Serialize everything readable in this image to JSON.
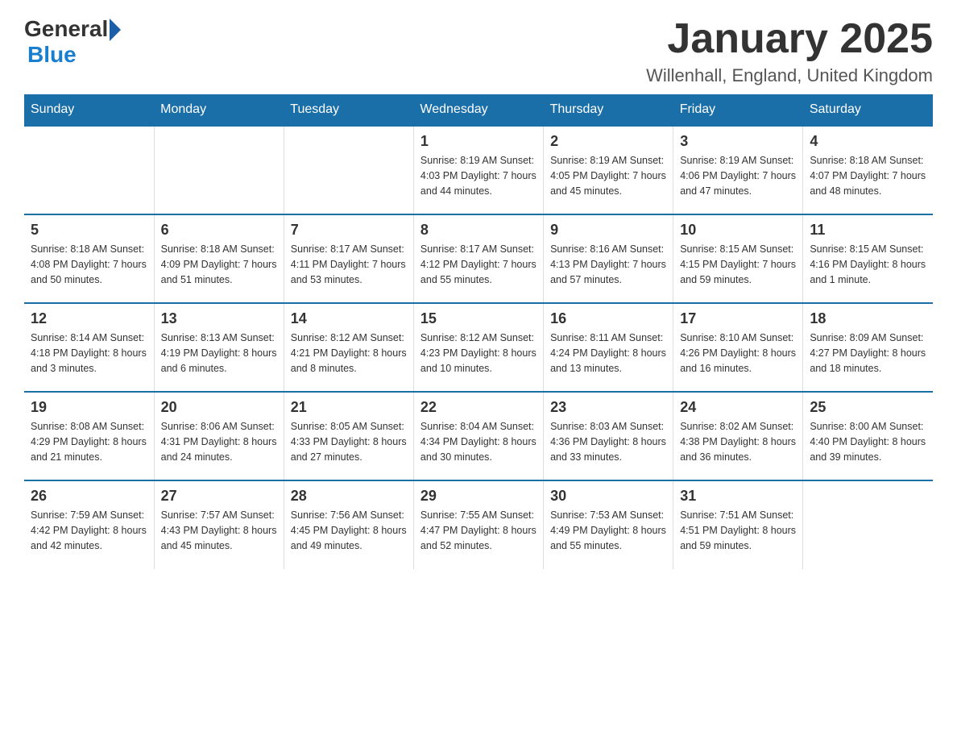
{
  "logo": {
    "text_general": "General",
    "text_blue": "Blue"
  },
  "title": "January 2025",
  "location": "Willenhall, England, United Kingdom",
  "headers": [
    "Sunday",
    "Monday",
    "Tuesday",
    "Wednesday",
    "Thursday",
    "Friday",
    "Saturday"
  ],
  "weeks": [
    [
      {
        "day": "",
        "info": ""
      },
      {
        "day": "",
        "info": ""
      },
      {
        "day": "",
        "info": ""
      },
      {
        "day": "1",
        "info": "Sunrise: 8:19 AM\nSunset: 4:03 PM\nDaylight: 7 hours\nand 44 minutes."
      },
      {
        "day": "2",
        "info": "Sunrise: 8:19 AM\nSunset: 4:05 PM\nDaylight: 7 hours\nand 45 minutes."
      },
      {
        "day": "3",
        "info": "Sunrise: 8:19 AM\nSunset: 4:06 PM\nDaylight: 7 hours\nand 47 minutes."
      },
      {
        "day": "4",
        "info": "Sunrise: 8:18 AM\nSunset: 4:07 PM\nDaylight: 7 hours\nand 48 minutes."
      }
    ],
    [
      {
        "day": "5",
        "info": "Sunrise: 8:18 AM\nSunset: 4:08 PM\nDaylight: 7 hours\nand 50 minutes."
      },
      {
        "day": "6",
        "info": "Sunrise: 8:18 AM\nSunset: 4:09 PM\nDaylight: 7 hours\nand 51 minutes."
      },
      {
        "day": "7",
        "info": "Sunrise: 8:17 AM\nSunset: 4:11 PM\nDaylight: 7 hours\nand 53 minutes."
      },
      {
        "day": "8",
        "info": "Sunrise: 8:17 AM\nSunset: 4:12 PM\nDaylight: 7 hours\nand 55 minutes."
      },
      {
        "day": "9",
        "info": "Sunrise: 8:16 AM\nSunset: 4:13 PM\nDaylight: 7 hours\nand 57 minutes."
      },
      {
        "day": "10",
        "info": "Sunrise: 8:15 AM\nSunset: 4:15 PM\nDaylight: 7 hours\nand 59 minutes."
      },
      {
        "day": "11",
        "info": "Sunrise: 8:15 AM\nSunset: 4:16 PM\nDaylight: 8 hours\nand 1 minute."
      }
    ],
    [
      {
        "day": "12",
        "info": "Sunrise: 8:14 AM\nSunset: 4:18 PM\nDaylight: 8 hours\nand 3 minutes."
      },
      {
        "day": "13",
        "info": "Sunrise: 8:13 AM\nSunset: 4:19 PM\nDaylight: 8 hours\nand 6 minutes."
      },
      {
        "day": "14",
        "info": "Sunrise: 8:12 AM\nSunset: 4:21 PM\nDaylight: 8 hours\nand 8 minutes."
      },
      {
        "day": "15",
        "info": "Sunrise: 8:12 AM\nSunset: 4:23 PM\nDaylight: 8 hours\nand 10 minutes."
      },
      {
        "day": "16",
        "info": "Sunrise: 8:11 AM\nSunset: 4:24 PM\nDaylight: 8 hours\nand 13 minutes."
      },
      {
        "day": "17",
        "info": "Sunrise: 8:10 AM\nSunset: 4:26 PM\nDaylight: 8 hours\nand 16 minutes."
      },
      {
        "day": "18",
        "info": "Sunrise: 8:09 AM\nSunset: 4:27 PM\nDaylight: 8 hours\nand 18 minutes."
      }
    ],
    [
      {
        "day": "19",
        "info": "Sunrise: 8:08 AM\nSunset: 4:29 PM\nDaylight: 8 hours\nand 21 minutes."
      },
      {
        "day": "20",
        "info": "Sunrise: 8:06 AM\nSunset: 4:31 PM\nDaylight: 8 hours\nand 24 minutes."
      },
      {
        "day": "21",
        "info": "Sunrise: 8:05 AM\nSunset: 4:33 PM\nDaylight: 8 hours\nand 27 minutes."
      },
      {
        "day": "22",
        "info": "Sunrise: 8:04 AM\nSunset: 4:34 PM\nDaylight: 8 hours\nand 30 minutes."
      },
      {
        "day": "23",
        "info": "Sunrise: 8:03 AM\nSunset: 4:36 PM\nDaylight: 8 hours\nand 33 minutes."
      },
      {
        "day": "24",
        "info": "Sunrise: 8:02 AM\nSunset: 4:38 PM\nDaylight: 8 hours\nand 36 minutes."
      },
      {
        "day": "25",
        "info": "Sunrise: 8:00 AM\nSunset: 4:40 PM\nDaylight: 8 hours\nand 39 minutes."
      }
    ],
    [
      {
        "day": "26",
        "info": "Sunrise: 7:59 AM\nSunset: 4:42 PM\nDaylight: 8 hours\nand 42 minutes."
      },
      {
        "day": "27",
        "info": "Sunrise: 7:57 AM\nSunset: 4:43 PM\nDaylight: 8 hours\nand 45 minutes."
      },
      {
        "day": "28",
        "info": "Sunrise: 7:56 AM\nSunset: 4:45 PM\nDaylight: 8 hours\nand 49 minutes."
      },
      {
        "day": "29",
        "info": "Sunrise: 7:55 AM\nSunset: 4:47 PM\nDaylight: 8 hours\nand 52 minutes."
      },
      {
        "day": "30",
        "info": "Sunrise: 7:53 AM\nSunset: 4:49 PM\nDaylight: 8 hours\nand 55 minutes."
      },
      {
        "day": "31",
        "info": "Sunrise: 7:51 AM\nSunset: 4:51 PM\nDaylight: 8 hours\nand 59 minutes."
      },
      {
        "day": "",
        "info": ""
      }
    ]
  ]
}
